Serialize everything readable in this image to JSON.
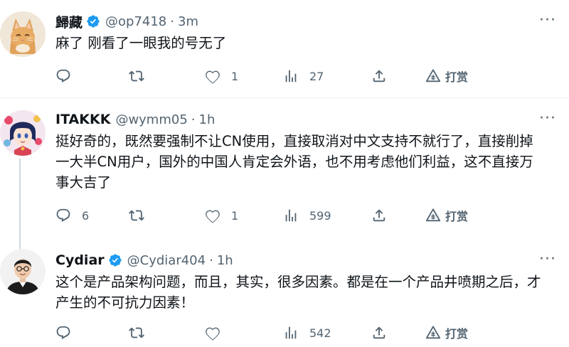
{
  "tweets": [
    {
      "name": "歸藏",
      "handle": "@op7418",
      "sep": "·",
      "time": "3m",
      "text": "麻了 刚看了一眼我的号无了",
      "replies": "",
      "likes": "1",
      "views": "27",
      "tip_label": "打赏"
    },
    {
      "name": "ITAKKK",
      "handle": "@wymm05",
      "sep": "·",
      "time": "1h",
      "text": "挺好奇的，既然要强制不让CN使用，直接取消对中文支持不就行了，直接削掉一大半CN用户，国外的中国人肯定会外语，也不用考虑他们利益，这不直接万事大吉了",
      "replies": "6",
      "likes": "1",
      "views": "599",
      "tip_label": "打赏"
    },
    {
      "name": "Cydiar",
      "handle": "@Cydiar404",
      "sep": "·",
      "time": "1h",
      "text": "这个是产品架构问题，而且，其实，很多因素。都是在一个产品井喷期之后，才产生的不可抗力因素！",
      "replies": "",
      "likes": "",
      "views": "542",
      "tip_label": "打赏"
    }
  ],
  "more_glyph": "···",
  "colors": {
    "verified": "#1d9bf0",
    "text": "#0f1419",
    "secondary": "#536471",
    "divider": "#eff3f4",
    "thread_line": "#cfd9de"
  },
  "icons": [
    "reply-icon",
    "retweet-icon",
    "like-icon",
    "views-icon",
    "share-icon",
    "tip-icon",
    "verified-badge-icon",
    "more-icon"
  ]
}
